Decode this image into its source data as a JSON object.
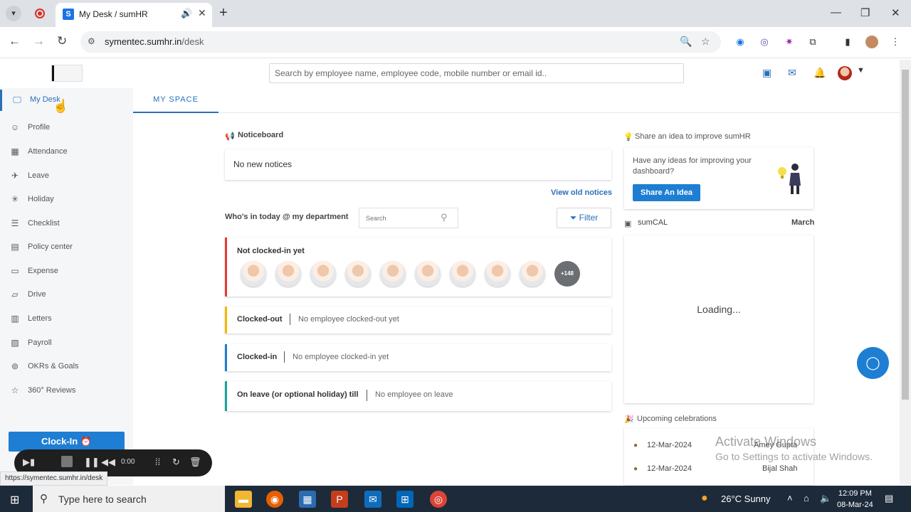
{
  "browser": {
    "tab_title": "My Desk / sumHR",
    "tab_favicon": "S",
    "url_host": "symentec.sumhr.in",
    "url_path": "/desk",
    "status_url": "https://symentec.sumhr.in/desk"
  },
  "header": {
    "search_placeholder": "Search by employee name, employee code, mobile number or email id.."
  },
  "sidebar": {
    "items": [
      {
        "label": "My Desk",
        "icon": "monitor-icon"
      },
      {
        "label": "Profile",
        "icon": "user-icon"
      },
      {
        "label": "Attendance",
        "icon": "calendar-icon"
      },
      {
        "label": "Leave",
        "icon": "plane-icon"
      },
      {
        "label": "Holiday",
        "icon": "sparkle-icon"
      },
      {
        "label": "Checklist",
        "icon": "checklist-icon"
      },
      {
        "label": "Policy center",
        "icon": "document-icon"
      },
      {
        "label": "Expense",
        "icon": "wallet-icon"
      },
      {
        "label": "Drive",
        "icon": "folder-icon"
      },
      {
        "label": "Letters",
        "icon": "letter-icon"
      },
      {
        "label": "Payroll",
        "icon": "payroll-icon"
      },
      {
        "label": "OKRs & Goals",
        "icon": "target-icon"
      },
      {
        "label": "360° Reviews",
        "icon": "star-icon"
      }
    ],
    "clockin_label": "Clock-In ⏰"
  },
  "tabs": {
    "my_space": "MY SPACE"
  },
  "noticeboard": {
    "title": "Noticeboard",
    "empty": "No new notices",
    "view_old": "View old notices"
  },
  "department": {
    "title": "Who's in today @ my department",
    "search_placeholder": "Search",
    "filter_label": "Filter",
    "not_clocked_title": "Not clocked-in yet",
    "more_count": "+148",
    "clocked_out_title": "Clocked-out",
    "clocked_out_msg": "No employee clocked-out yet",
    "clocked_in_title": "Clocked-in",
    "clocked_in_msg": "No employee clocked-in yet",
    "on_leave_title": "On leave (or optional holiday) till",
    "on_leave_msg": "No employee on leave"
  },
  "idea": {
    "title": "Share an idea to improve sumHR",
    "text": "Have any ideas for improving your dashboard?",
    "button": "Share An Idea"
  },
  "sumcal": {
    "title": "sumCAL",
    "month": "March",
    "loading": "Loading..."
  },
  "celebrations": {
    "title": "Upcoming celebrations",
    "items": [
      {
        "date": "12-Mar-2024",
        "name": "Amey Gupta"
      },
      {
        "date": "12-Mar-2024",
        "name": "Bijal Shah"
      }
    ]
  },
  "watermark": {
    "line1": "Activate Windows",
    "line2": "Go to Settings to activate Windows."
  },
  "recorder": {
    "time": "0:00"
  },
  "taskbar": {
    "search_text": "Type here to search",
    "weather": "26°C  Sunny",
    "time": "12:09 PM",
    "date": "08-Mar-24"
  },
  "colors": {
    "accent": "#2a6fb9",
    "button_blue": "#1e7ed3",
    "not_clocked": "#e53935",
    "clocked_out": "#f5b800",
    "clocked_in": "#1e7ed3",
    "on_leave": "#1aa39a"
  }
}
